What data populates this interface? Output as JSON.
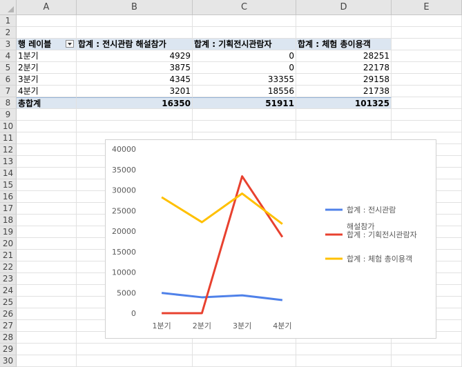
{
  "columns": [
    "A",
    "B",
    "C",
    "D",
    "E"
  ],
  "rows": [
    "1",
    "2",
    "3",
    "4",
    "5",
    "6",
    "7",
    "8",
    "9",
    "10",
    "11",
    "12",
    "13",
    "14",
    "15",
    "16",
    "17",
    "18",
    "19",
    "20",
    "21",
    "22",
    "23",
    "24",
    "25",
    "26",
    "27",
    "28",
    "29",
    "30"
  ],
  "pivot": {
    "row_label_header": "행 레이블",
    "headers": [
      "합계 : 전시관람 해설참가",
      "합계 : 기획전시관람자",
      "합계 : 체험 총이용객"
    ],
    "body": [
      [
        "1분기",
        "4929",
        "0",
        "28251"
      ],
      [
        "2분기",
        "3875",
        "0",
        "22178"
      ],
      [
        "3분기",
        "4345",
        "33355",
        "29158"
      ],
      [
        "4분기",
        "3201",
        "18556",
        "21738"
      ]
    ],
    "total": [
      "총합계",
      "16350",
      "51911",
      "101325"
    ]
  },
  "chart_data": {
    "type": "line",
    "categories": [
      "1분기",
      "2분기",
      "3분기",
      "4분기"
    ],
    "series": [
      {
        "name": "합계 : 전시관람 해설참가",
        "legend_lines": [
          "합계 : 전시관람",
          "해설참가"
        ],
        "color": "#4f81e9",
        "values": [
          4929,
          3875,
          4345,
          3201
        ]
      },
      {
        "name": "합계 : 기획전시관람자",
        "legend_lines": [
          "합계 : 기획전시관람자"
        ],
        "color": "#e8412f",
        "values": [
          0,
          0,
          33355,
          18556
        ]
      },
      {
        "name": "합계 : 체험 총이용객",
        "legend_lines": [
          "합계 : 체험 총이용객"
        ],
        "color": "#ffc000",
        "values": [
          28251,
          22178,
          29158,
          21738
        ]
      }
    ],
    "ylim": [
      0,
      40000
    ],
    "yticks": [
      "0",
      "5000",
      "10000",
      "15000",
      "20000",
      "25000",
      "30000",
      "35000",
      "40000"
    ],
    "grid": false,
    "legend": "right"
  }
}
